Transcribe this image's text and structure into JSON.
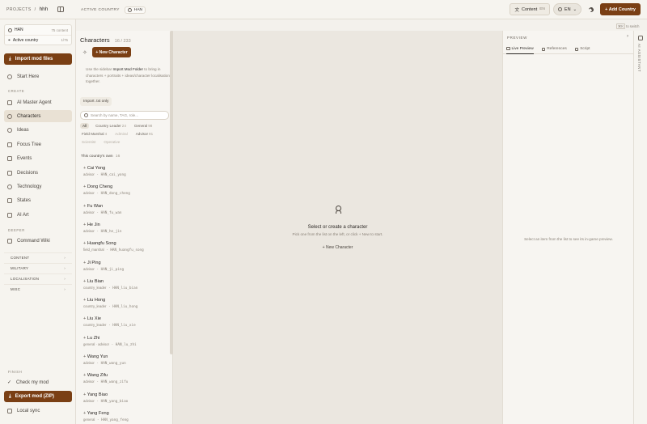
{
  "topbar": {
    "projects_label": "PROJECTS",
    "separator": "/",
    "project_name": "hhh",
    "active_country_label": "ACTIVE COUNTRY",
    "active_country_tag": "HAN",
    "content_label": "Content",
    "content_sub": "EN",
    "language": "EN",
    "add_country_label": "+ Add Country"
  },
  "sidebar": {
    "country_tag": "HAN",
    "country_meta": "75 content",
    "active_country_label": "Active country",
    "active_country_meta": "1/75",
    "import_label": "Import mod files",
    "start_here": "Start Here",
    "create_label": "CREATE",
    "create_items": [
      "AI Master Agent",
      "Characters",
      "Ideas",
      "Focus Tree",
      "Events",
      "Decisions",
      "Technology",
      "States",
      "AI Art"
    ],
    "deeper_label": "DEEPER",
    "command_wiki": "Command Wiki",
    "categories": [
      "CONTENT",
      "MILITARY",
      "LOCALISATION",
      "MISC"
    ],
    "finish_label": "FINISH",
    "check_mod": "Check my mod",
    "export_label": "Export mod (ZIP)",
    "local_sync": "Local sync"
  },
  "characters": {
    "title": "Characters",
    "count": "16 / 233",
    "new_button": "+ New Character",
    "hint_pre": "Use the sidebar",
    "hint_link": "Import Mod Folder",
    "hint_post": "to bring in characters + portraits + ideas/character localisation together.",
    "import_txt": "Import .txt only",
    "search_placeholder": "Search by name, TAG, role...",
    "filters": [
      {
        "label": "All",
        "n": "",
        "state": "on"
      },
      {
        "label": "Country Leader",
        "n": "24",
        "state": ""
      },
      {
        "label": "General",
        "n": "98",
        "state": ""
      },
      {
        "label": "Field Marshal",
        "n": "4",
        "state": ""
      },
      {
        "label": "Admiral",
        "n": "",
        "state": "dim"
      },
      {
        "label": "Advisor",
        "n": "91",
        "state": ""
      },
      {
        "label": "Scientist",
        "n": "",
        "state": "dim"
      },
      {
        "label": "Operative",
        "n": "",
        "state": "dim"
      }
    ],
    "own_label": "This country's own",
    "own_count": "16",
    "list": [
      {
        "name": "Cai Yong",
        "role": "advisor",
        "id": "HAN_cai_yong"
      },
      {
        "name": "Dong Cheng",
        "role": "advisor",
        "id": "HAN_dong_cheng"
      },
      {
        "name": "Fu Wan",
        "role": "advisor",
        "id": "HAN_fu_wan"
      },
      {
        "name": "He Jin",
        "role": "advisor",
        "id": "HAN_he_jin"
      },
      {
        "name": "Huangfu Song",
        "role": "field_marshal",
        "id": "HAN_huangfu_song"
      },
      {
        "name": "Ji Ping",
        "role": "advisor",
        "id": "HAN_ji_ping"
      },
      {
        "name": "Liu Bian",
        "role": "country_leader",
        "id": "HAN_liu_bian"
      },
      {
        "name": "Liu Hong",
        "role": "country_leader",
        "id": "HAN_liu_hong"
      },
      {
        "name": "Liu Xie",
        "role": "country_leader",
        "id": "HAN_liu_xie"
      },
      {
        "name": "Lu Zhi",
        "role": "general · advisor",
        "id": "HAN_lu_zhi"
      },
      {
        "name": "Wang Yun",
        "role": "advisor",
        "id": "HAN_wang_yun"
      },
      {
        "name": "Wang Zifu",
        "role": "advisor",
        "id": "HAN_wang_zifu"
      },
      {
        "name": "Yang Biao",
        "role": "advisor",
        "id": "HAN_yang_biao"
      },
      {
        "name": "Yang Feng",
        "role": "general",
        "id": "HAN_yang_feng"
      }
    ]
  },
  "center": {
    "title": "Select or create a character",
    "subtitle": "Pick one from the list on the left, or click + New to start.",
    "button": "+ New Character"
  },
  "preview": {
    "label": "PREVIEW",
    "tabs": [
      "Live Preview",
      "References",
      "Script"
    ],
    "empty": "Select an item from the list to see its in-game preview.",
    "rail_label": "AI ASSISTANT",
    "switch_hint": "to switch",
    "switch_key": "⌘K"
  }
}
